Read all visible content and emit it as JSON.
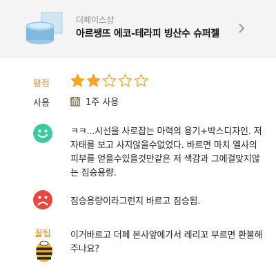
{
  "product": {
    "brand": "더페이스샵",
    "name": "아르쌩뜨 에코-테라피 빙산수 슈퍼젤"
  },
  "rating": {
    "label": "평점",
    "value": 2,
    "max": 5,
    "filled_color": "#f5a623",
    "empty_color": "#f5a623"
  },
  "usage": {
    "label": "사용",
    "value": "1주 사용"
  },
  "review": {
    "good": "ㅋㅋ...시선을 사로잡는 마력의 용기+박스디자인. 저 자태를 보고 사지않을수없었다. 바르면 마치 엘사의 피부를 얻을수있을것만같은 저 색감과 그에걸맞지않는 짐승용량.",
    "bad": "짐승용량이라그런지 바르고 짐승됨.",
    "tip_label": "꿀팁",
    "tip": "이거바르고 더페 본사앞에가서 레리꼬 부르면 환불해주나요?"
  },
  "colors": {
    "good_face": "#3bc9a0",
    "bad_face": "#e8483f",
    "accent": "#f08a2a"
  }
}
